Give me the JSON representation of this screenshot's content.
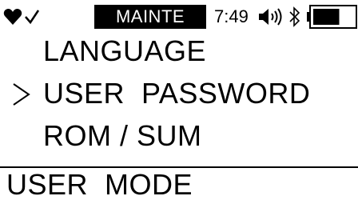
{
  "status_bar": {
    "icons": [
      "heart-icon",
      "checkmark-icon",
      "speaker-icon",
      "bluetooth-icon",
      "battery-icon"
    ],
    "mode": "MAINTE",
    "time": "7:49",
    "battery_level": 0.65
  },
  "menu": {
    "cursor_icon": "chevron-right-icon",
    "selected_index": 1,
    "items": [
      {
        "label": "LANGUAGE"
      },
      {
        "label": "USER  PASSWORD"
      },
      {
        "label": "ROM / SUM"
      }
    ]
  },
  "footer": {
    "label": "USER  MODE"
  },
  "colors": {
    "background": "#ffffff",
    "foreground": "#000000"
  }
}
